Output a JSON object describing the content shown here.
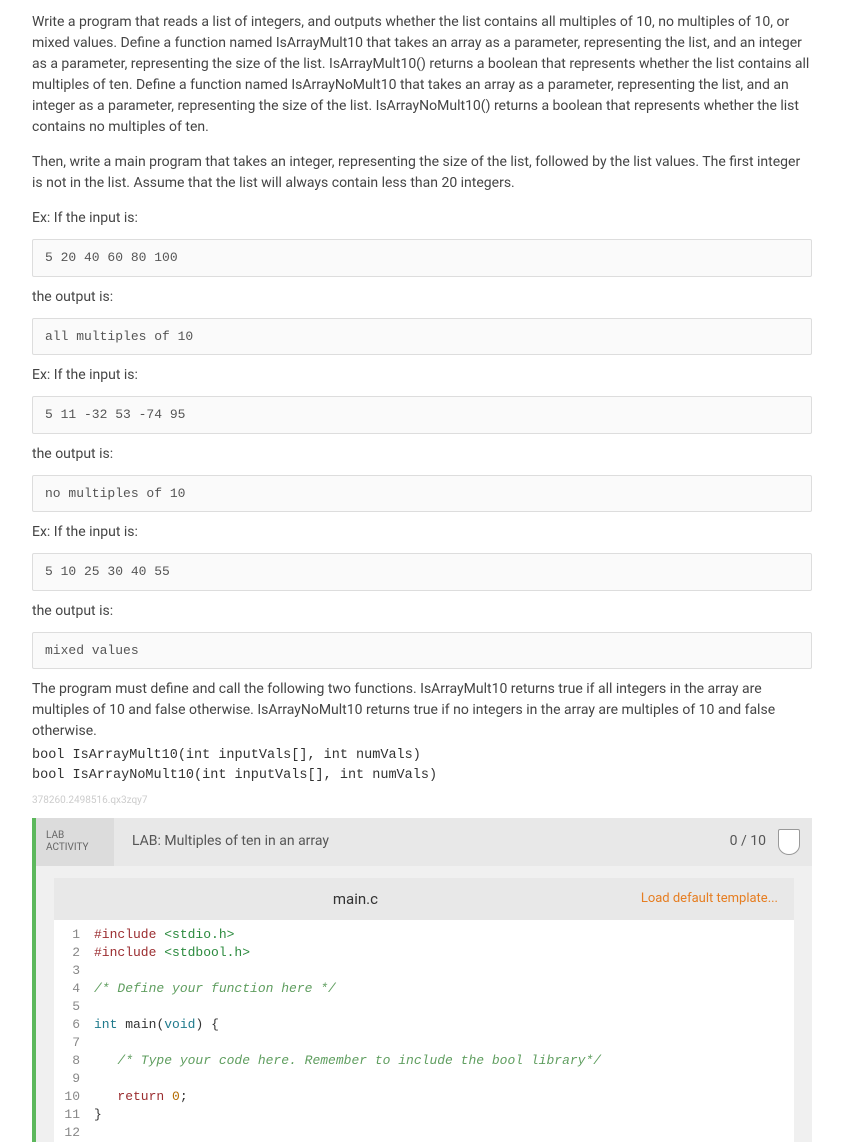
{
  "description": {
    "para1": "Write a program that reads a list of integers, and outputs whether the list contains all multiples of 10, no multiples of 10, or mixed values. Define a function named IsArrayMult10 that takes an array as a parameter, representing the list, and an integer as a parameter, representing the size of the list. IsArrayMult10() returns a boolean that represents whether the list contains all multiples of ten. Define a function named IsArrayNoMult10 that takes an array as a parameter, representing the list, and an integer as a parameter, representing the size of the list. IsArrayNoMult10() returns a boolean that represents whether the list contains no multiples of ten.",
    "para2": "Then, write a main program that takes an integer, representing the size of the list, followed by the list values. The first integer is not in the list. Assume that the list will always contain less than 20 integers."
  },
  "examples": [
    {
      "intro": "Ex: If the input is:",
      "input": "5 20 40 60 80 100",
      "out_intro": "the output is:",
      "output": "all multiples of 10"
    },
    {
      "intro": "Ex: If the input is:",
      "input": "5 11 -32 53 -74 95",
      "out_intro": "the output is:",
      "output": "no multiples of 10"
    },
    {
      "intro": "Ex: If the input is:",
      "input": "5 10 25 30 40 55",
      "out_intro": "the output is:",
      "output": "mixed values"
    }
  ],
  "footer_para": "The program must define and call the following two functions. IsArrayMult10 returns true if all integers in the array are multiples of 10 and false otherwise. IsArrayNoMult10 returns true if no integers in the array are multiples of 10 and false otherwise.",
  "signatures": [
    "bool IsArrayMult10(int inputVals[], int numVals)",
    "bool IsArrayNoMult10(int inputVals[], int numVals)"
  ],
  "watermark": "378260.2498516.qx3zqy7",
  "lab": {
    "badge_line1": "LAB",
    "badge_line2": "ACTIVITY",
    "title": "LAB: Multiples of ten in an array",
    "score": "0 / 10",
    "file_name": "main.c",
    "load_template": "Load default template..."
  },
  "code": {
    "lines": [
      {
        "n": 1,
        "segments": [
          {
            "t": "#include ",
            "c": "s-include"
          },
          {
            "t": "<stdio.h>",
            "c": "s-header"
          }
        ]
      },
      {
        "n": 2,
        "segments": [
          {
            "t": "#include ",
            "c": "s-include"
          },
          {
            "t": "<stdbool.h>",
            "c": "s-header"
          }
        ]
      },
      {
        "n": 3,
        "segments": [
          {
            "t": "",
            "c": ""
          }
        ]
      },
      {
        "n": 4,
        "segments": [
          {
            "t": "/* Define your function here */",
            "c": "s-comment"
          }
        ]
      },
      {
        "n": 5,
        "segments": [
          {
            "t": "",
            "c": ""
          }
        ]
      },
      {
        "n": 6,
        "segments": [
          {
            "t": "int ",
            "c": "s-type"
          },
          {
            "t": "main",
            "c": "s-fn"
          },
          {
            "t": "(",
            "c": "s-punc"
          },
          {
            "t": "void",
            "c": "s-type"
          },
          {
            "t": ") {",
            "c": "s-punc"
          }
        ]
      },
      {
        "n": 7,
        "segments": [
          {
            "t": "",
            "c": ""
          }
        ]
      },
      {
        "n": 8,
        "segments": [
          {
            "t": "   ",
            "c": ""
          },
          {
            "t": "/* Type your code here. Remember to include the bool library*/",
            "c": "s-comment"
          }
        ]
      },
      {
        "n": 9,
        "segments": [
          {
            "t": "",
            "c": ""
          }
        ]
      },
      {
        "n": 10,
        "segments": [
          {
            "t": "   ",
            "c": ""
          },
          {
            "t": "return ",
            "c": "s-ret"
          },
          {
            "t": "0",
            "c": "s-num"
          },
          {
            "t": ";",
            "c": "s-punc"
          }
        ]
      },
      {
        "n": 11,
        "segments": [
          {
            "t": "}",
            "c": "s-punc"
          }
        ]
      },
      {
        "n": 12,
        "segments": [
          {
            "t": "",
            "c": ""
          }
        ]
      }
    ]
  }
}
